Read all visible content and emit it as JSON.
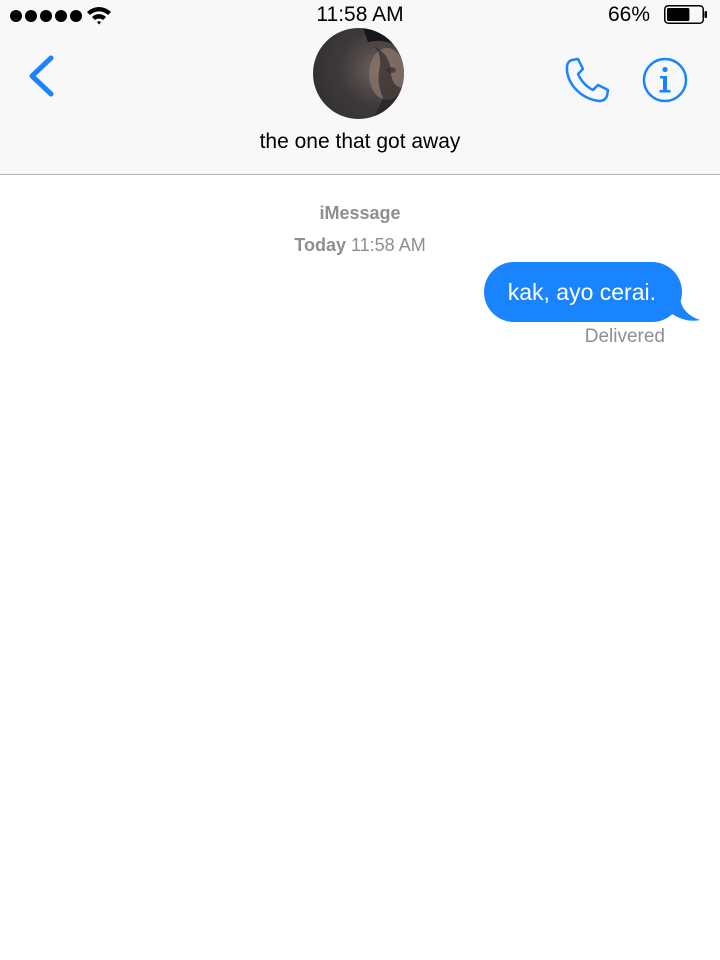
{
  "status_bar": {
    "time": "11:58 AM",
    "battery_percent": "66%",
    "battery_level": 0.66,
    "signal_icon": "signal-dots-icon",
    "wifi_icon": "wifi-icon"
  },
  "header": {
    "back_icon": "chevron-left-icon",
    "contact_name": "the one that got away",
    "call_icon": "phone-icon",
    "info_icon": "info-icon"
  },
  "conversation": {
    "service": "iMessage",
    "date_label": "Today",
    "time_label": "11:58 AM",
    "messages": [
      {
        "direction": "outgoing",
        "text": "kak, ayo cerai.",
        "status": "Delivered"
      }
    ]
  },
  "colors": {
    "accent": "#1a84ff",
    "secondary_text": "#8e8e93",
    "header_background": "#f8f8f8"
  }
}
